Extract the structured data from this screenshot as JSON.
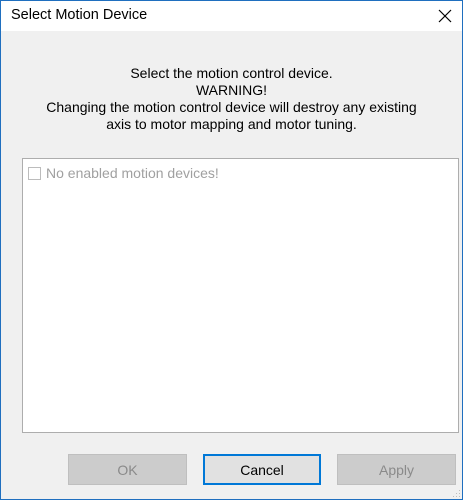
{
  "window": {
    "title": "Select Motion Device"
  },
  "message": {
    "line1": "Select the motion control device.",
    "line2": "WARNING!",
    "line3": "Changing the motion control device will destroy any existing",
    "line4": "axis to motor mapping and motor tuning."
  },
  "device_list": {
    "items": [
      {
        "label": "No enabled motion devices!",
        "checked": false,
        "enabled": false
      }
    ]
  },
  "buttons": {
    "ok_label": "OK",
    "cancel_label": "Cancel",
    "apply_label": "Apply"
  },
  "colors": {
    "window_border": "#1f6fbf",
    "focus_border": "#0078d7",
    "disabled_text": "#a0a0a0"
  },
  "icons": {
    "close": "close-icon",
    "size_grip": "resize-grip-icon"
  }
}
